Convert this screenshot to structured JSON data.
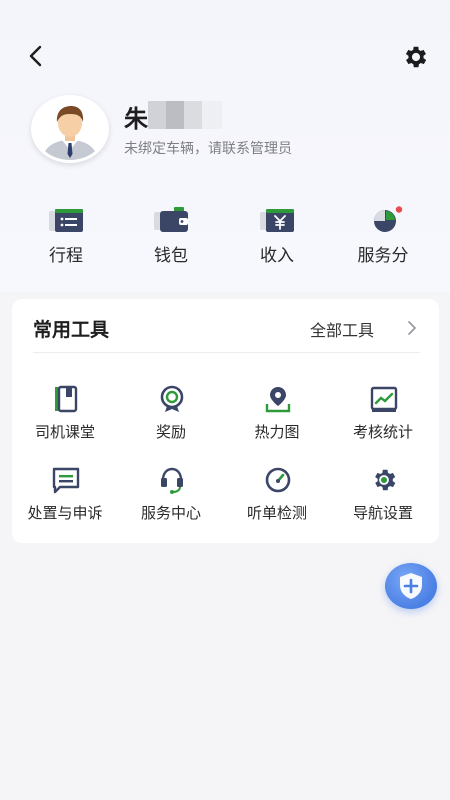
{
  "header": {
    "back_icon": "chevron-left-icon",
    "settings_icon": "gear-icon"
  },
  "profile": {
    "name": "朱",
    "subtitle": "未绑定车辆，请联系管理员"
  },
  "quick_actions": [
    {
      "label": "行程",
      "icon": "trip-list-icon"
    },
    {
      "label": "钱包",
      "icon": "wallet-icon"
    },
    {
      "label": "收入",
      "icon": "income-yuan-icon"
    },
    {
      "label": "服务分",
      "icon": "pie-chart-icon",
      "badge": true
    }
  ],
  "tools": {
    "title": "常用工具",
    "all_label": "全部工具",
    "items": [
      {
        "label": "司机课堂",
        "icon": "book-icon"
      },
      {
        "label": "奖励",
        "icon": "award-icon"
      },
      {
        "label": "热力图",
        "icon": "map-pin-icon"
      },
      {
        "label": "考核统计",
        "icon": "trend-chart-icon"
      },
      {
        "label": "处置与申诉",
        "icon": "message-icon"
      },
      {
        "label": "服务中心",
        "icon": "headset-icon"
      },
      {
        "label": "听单检测",
        "icon": "gauge-icon"
      },
      {
        "label": "导航设置",
        "icon": "settings-gear-icon"
      }
    ]
  },
  "colors": {
    "accent_green": "#2f9a3a",
    "icon_navy": "#3b4566",
    "badge_red": "#e84b4b",
    "fab_blue": "#4a7fe4"
  }
}
